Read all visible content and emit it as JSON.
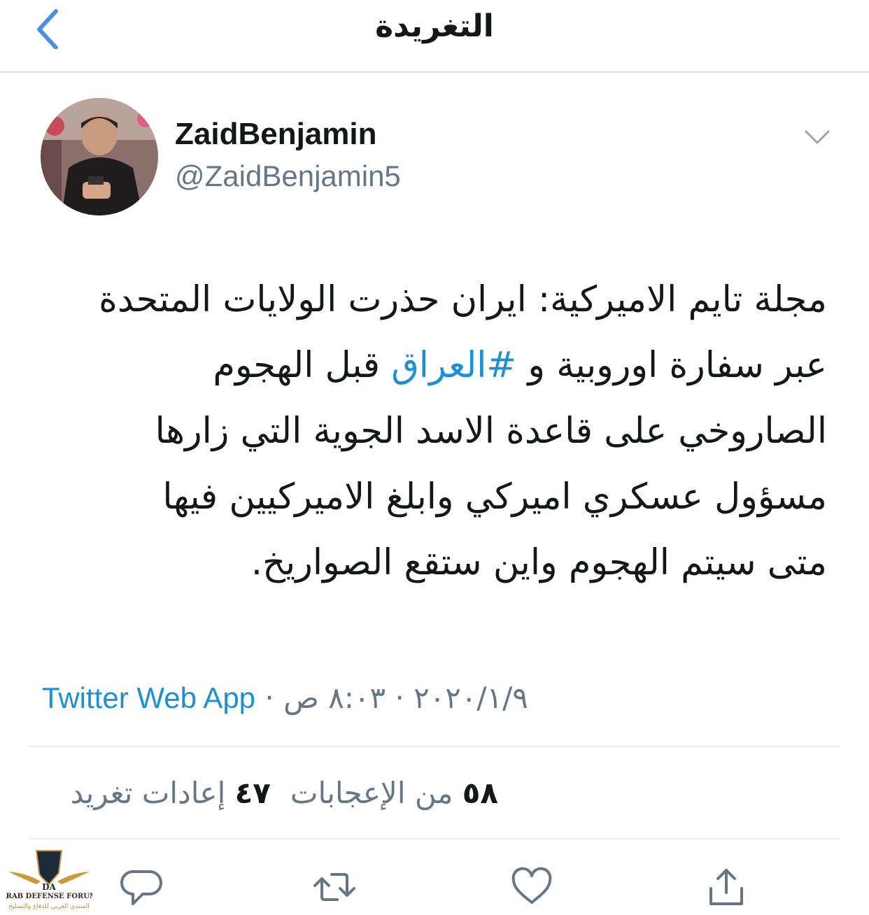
{
  "header": {
    "title": "التغريدة",
    "back_icon": "chevron-left-icon"
  },
  "author": {
    "display_name": "ZaidBenjamin",
    "handle": "@ZaidBenjamin5"
  },
  "tweet": {
    "lines": [
      "مجلة تايم الاميركية: ايران حذرت الولايات المتحدة",
      {
        "before": "عبر سفارة اوروبية و ",
        "hashtag": "#العراق",
        "after": " قبل الهجوم"
      },
      "الصاروخي على قاعدة الاسد الجوية التي زارها",
      "مسؤول عسكري اميركي وابلغ الاميركيين فيها",
      "متى سيتم الهجوم واين ستقع الصواريخ."
    ]
  },
  "meta": {
    "time": "٨:٠٣ ص",
    "date": "٢٠٢٠/١/٩",
    "separator": "·",
    "source": "Twitter Web App"
  },
  "stats": {
    "retweets_count": "٤٧",
    "retweets_label": "إعادات تغريد",
    "likes_count": "٥٨",
    "likes_label": "من الإعجابات"
  },
  "actions": [
    "reply-icon",
    "retweet-icon",
    "like-icon",
    "share-icon"
  ],
  "watermark": {
    "logo": "DA",
    "line1": "ARAB DEFENSE FORUM",
    "line2": "المنتدى العربي للدفاع والتسليح"
  },
  "colors": {
    "link": "#1d8fd3",
    "secondary": "#657786",
    "text": "#14171a",
    "back": "#4a90e2"
  }
}
